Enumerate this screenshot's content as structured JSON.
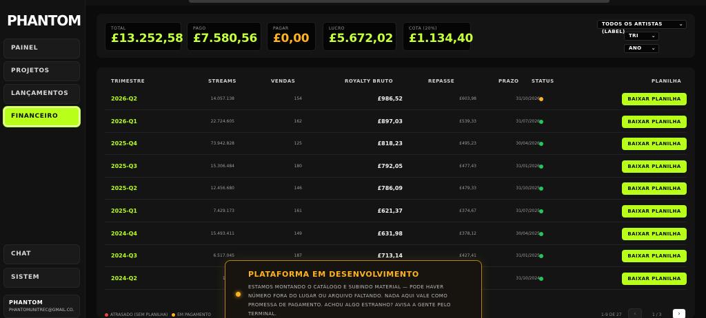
{
  "app": {
    "logo": "PHANTOM"
  },
  "sidebar": {
    "items": [
      {
        "label": "PAINEL"
      },
      {
        "label": "PROJETOS"
      },
      {
        "label": "LANÇAMENTOS"
      },
      {
        "label": "FINANCEIRO",
        "active": true
      },
      {
        "label": "CHAT"
      },
      {
        "label": "SISTEM"
      }
    ],
    "user": {
      "name": "PHANTOM",
      "email": "PHANTOMUNITREC@GMAIL.CO..."
    }
  },
  "kpis": [
    {
      "label": "TOTAL",
      "value": "£13.252,58",
      "color": "#c4ff3a"
    },
    {
      "label": "PAGO",
      "value": "£7.580,56",
      "color": "#c4ff3a"
    },
    {
      "label": "PAGAR",
      "value": "£0,00",
      "color": "#ffb21f"
    },
    {
      "label": "LUCRO",
      "value": "£5.672,02",
      "color": "#c4ff3a"
    },
    {
      "label": "COTA (20%)",
      "value": "£1.134,40",
      "color": "#c4ff3a"
    }
  ],
  "filters": {
    "artist": "TODOS OS ARTISTAS (LABEL)",
    "period": "TRI",
    "year": "ANO"
  },
  "table": {
    "headers": {
      "period": "TRIMESTRE",
      "streams": "STREAMS",
      "sales": "VENDAS",
      "royalty": "ROYALTY BRUTO",
      "payout": "REPASSE",
      "deadline": "PRAZO",
      "status": "STATUS",
      "sheet": "PLANILHA"
    },
    "download_label": "BAIXAR PLANILHA",
    "rows": [
      {
        "period": "2026-Q2",
        "streams": "14.057.138",
        "sales": "154",
        "royalty": "£986,52",
        "payout": "£603,98",
        "deadline": "31/10/2026",
        "status": "pending"
      },
      {
        "period": "2026-Q1",
        "streams": "22.724.605",
        "sales": "162",
        "royalty": "£897,03",
        "payout": "£539,33",
        "deadline": "31/07/2026",
        "status": "paid"
      },
      {
        "period": "2025-Q4",
        "streams": "73.942.828",
        "sales": "125",
        "royalty": "£818,23",
        "payout": "£495,23",
        "deadline": "30/04/2026",
        "status": "paid"
      },
      {
        "period": "2025-Q3",
        "streams": "15.306.484",
        "sales": "180",
        "royalty": "£792,05",
        "payout": "£477,43",
        "deadline": "31/01/2026",
        "status": "paid"
      },
      {
        "period": "2025-Q2",
        "streams": "12.456.680",
        "sales": "146",
        "royalty": "£786,09",
        "payout": "£479,33",
        "deadline": "31/10/2025",
        "status": "paid"
      },
      {
        "period": "2025-Q1",
        "streams": "7.429.173",
        "sales": "161",
        "royalty": "£621,37",
        "payout": "£374,67",
        "deadline": "31/07/2025",
        "status": "paid"
      },
      {
        "period": "2024-Q4",
        "streams": "15.493.411",
        "sales": "149",
        "royalty": "£631,98",
        "payout": "£378,12",
        "deadline": "30/04/2025",
        "status": "paid"
      },
      {
        "period": "2024-Q3",
        "streams": "6.517.045",
        "sales": "187",
        "royalty": "£713,14",
        "payout": "£427,41",
        "deadline": "31/01/2025",
        "status": "paid"
      },
      {
        "period": "2024-Q2",
        "streams": "1.836",
        "sales": "",
        "royalty": "",
        "payout": "",
        "deadline": "31/10/2024",
        "status": "paid"
      }
    ]
  },
  "status_colors": {
    "pending": "#ffb21f",
    "paid": "#22c55e",
    "late": "#ef4444"
  },
  "legend": [
    {
      "label": "ATRASADO (SEM PLANILHA)",
      "color": "#ef4444"
    },
    {
      "label": "EM PAGAMENTO",
      "color": "#ffb21f"
    }
  ],
  "pagination": {
    "range": "1-9 DE 27",
    "page": "1 / 3",
    "prev": "‹",
    "next": "›"
  },
  "toast": {
    "title": "PLATAFORMA EM DESENVOLVIMENTO",
    "body": "ESTAMOS MONTANDO O CATÁLOGO E SUBINDO MATERIAL — PODE HAVER NÚMERO FORA DO LUGAR OU ARQUIVO FALTANDO. NADA AQUI VALE COMO PROMESSA DE PAGAMENTO. ACHOU ALGO ESTRANHO? AVISA A GENTE PELO TERMINAL."
  }
}
